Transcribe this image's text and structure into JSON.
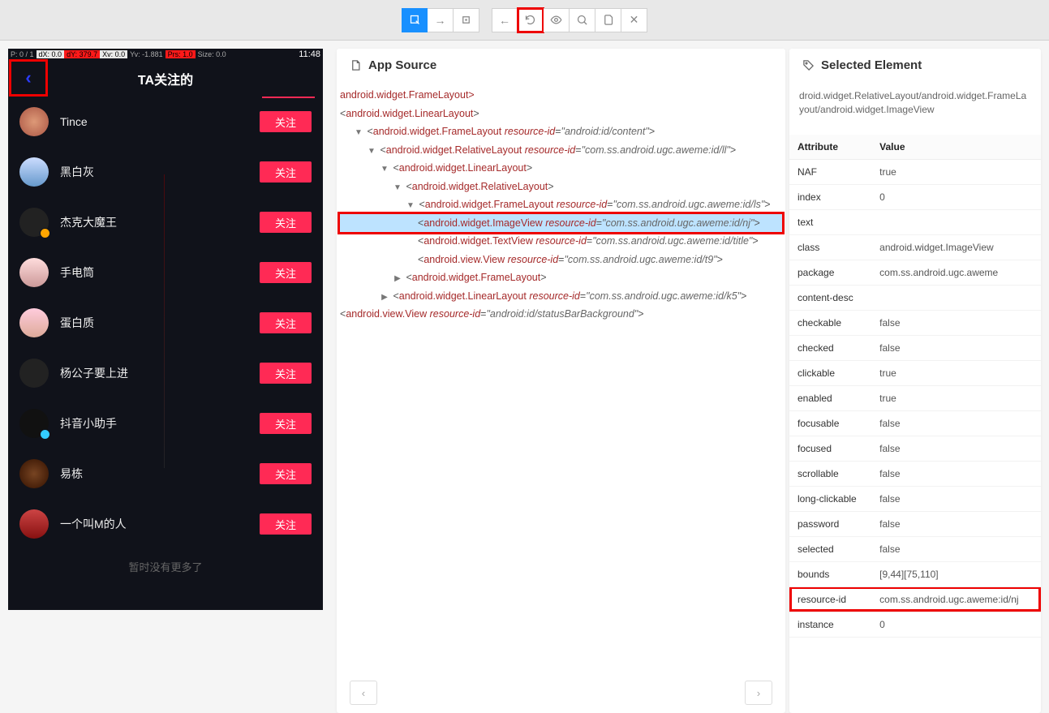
{
  "toolbar": {
    "buttons_a": [
      "expand-icon",
      "arrow-right-icon",
      "screenshot-icon"
    ],
    "buttons_b": [
      "back-icon",
      "refresh-icon",
      "eye-icon",
      "search-icon",
      "copy-icon",
      "close-icon"
    ]
  },
  "phone": {
    "status_left": [
      "P: 0 / 1",
      "dX: 0.0",
      "dY: 379.7",
      "Xv: 0.0",
      "Yv: -1.881",
      "Prs: 1.0",
      "Size: 0.0"
    ],
    "status_right": "11:48",
    "title": "TA关注的",
    "users": [
      {
        "name": "Tince",
        "avatar": "one"
      },
      {
        "name": "黑白灰",
        "avatar": "two"
      },
      {
        "name": "杰克大魔王",
        "avatar": "three",
        "badge": "v"
      },
      {
        "name": "手电筒",
        "avatar": "four"
      },
      {
        "name": "蛋白质",
        "avatar": "five"
      },
      {
        "name": "杨公子要上进",
        "avatar": "six"
      },
      {
        "name": "抖音小助手",
        "avatar": "seven",
        "badge": "b"
      },
      {
        "name": "易栋",
        "avatar": "eight"
      },
      {
        "name": "一个叫M的人",
        "avatar": "nine"
      }
    ],
    "follow_label": "关注",
    "footer": "暂时没有更多了"
  },
  "app_source": {
    "title": "App Source",
    "lines": [
      {
        "indent": -1,
        "text": "android.widget.FrameLayout>"
      },
      {
        "indent": 0,
        "tag": "android.widget.LinearLayout"
      },
      {
        "indent": 1,
        "toggle": "v",
        "tag": "android.widget.FrameLayout",
        "attr": "resource-id",
        "val": "\"android:id/content\""
      },
      {
        "indent": 2,
        "toggle": "v",
        "tag": "android.widget.RelativeLayout",
        "attr": "resource-id",
        "val": "\"com.ss.android.ugc.aweme:id/ll\""
      },
      {
        "indent": 3,
        "toggle": "v",
        "tag": "android.widget.LinearLayout"
      },
      {
        "indent": 4,
        "toggle": "v",
        "tag": "android.widget.RelativeLayout"
      },
      {
        "indent": 5,
        "toggle": "v",
        "tag": "android.widget.FrameLayout",
        "attr": "resource-id",
        "val": "\"com.ss.android.ugc.aweme:id/ls\""
      },
      {
        "indent": 6,
        "sel": true,
        "tag": "android.widget.ImageView",
        "attr": "resource-id",
        "val": "\"com.ss.android.ugc.aweme:id/nj\""
      },
      {
        "indent": 6,
        "tag": "android.widget.TextView",
        "attr": "resource-id",
        "val": "\"com.ss.android.ugc.aweme:id/title\""
      },
      {
        "indent": 6,
        "tag": "android.view.View",
        "attr": "resource-id",
        "val": "\"com.ss.android.ugc.aweme:id/t9\""
      },
      {
        "indent": 4,
        "toggle": ">",
        "tag": "android.widget.FrameLayout"
      },
      {
        "indent": 3,
        "toggle": ">",
        "tag": "android.widget.LinearLayout",
        "attr": "resource-id",
        "val": "\"com.ss.android.ugc.aweme:id/k5\""
      },
      {
        "indent": 0,
        "tag": "android.view.View",
        "attr": "resource-id",
        "val": "\"android:id/statusBarBackground\""
      }
    ]
  },
  "selected": {
    "title": "Selected Element",
    "xpath": "droid.widget.RelativeLayout/android.widget.FrameLayout/android.widget.ImageView",
    "th_attr": "Attribute",
    "th_val": "Value",
    "rows": [
      {
        "k": "NAF",
        "v": "true"
      },
      {
        "k": "index",
        "v": "0"
      },
      {
        "k": "text",
        "v": ""
      },
      {
        "k": "class",
        "v": "android.widget.ImageView"
      },
      {
        "k": "package",
        "v": "com.ss.android.ugc.aweme"
      },
      {
        "k": "content-desc",
        "v": ""
      },
      {
        "k": "checkable",
        "v": "false"
      },
      {
        "k": "checked",
        "v": "false"
      },
      {
        "k": "clickable",
        "v": "true"
      },
      {
        "k": "enabled",
        "v": "true"
      },
      {
        "k": "focusable",
        "v": "false"
      },
      {
        "k": "focused",
        "v": "false"
      },
      {
        "k": "scrollable",
        "v": "false"
      },
      {
        "k": "long-clickable",
        "v": "false"
      },
      {
        "k": "password",
        "v": "false"
      },
      {
        "k": "selected",
        "v": "false"
      },
      {
        "k": "bounds",
        "v": "[9,44][75,110]"
      },
      {
        "k": "resource-id",
        "v": "com.ss.android.ugc.aweme:id/nj",
        "hl": true
      },
      {
        "k": "instance",
        "v": "0"
      }
    ]
  }
}
